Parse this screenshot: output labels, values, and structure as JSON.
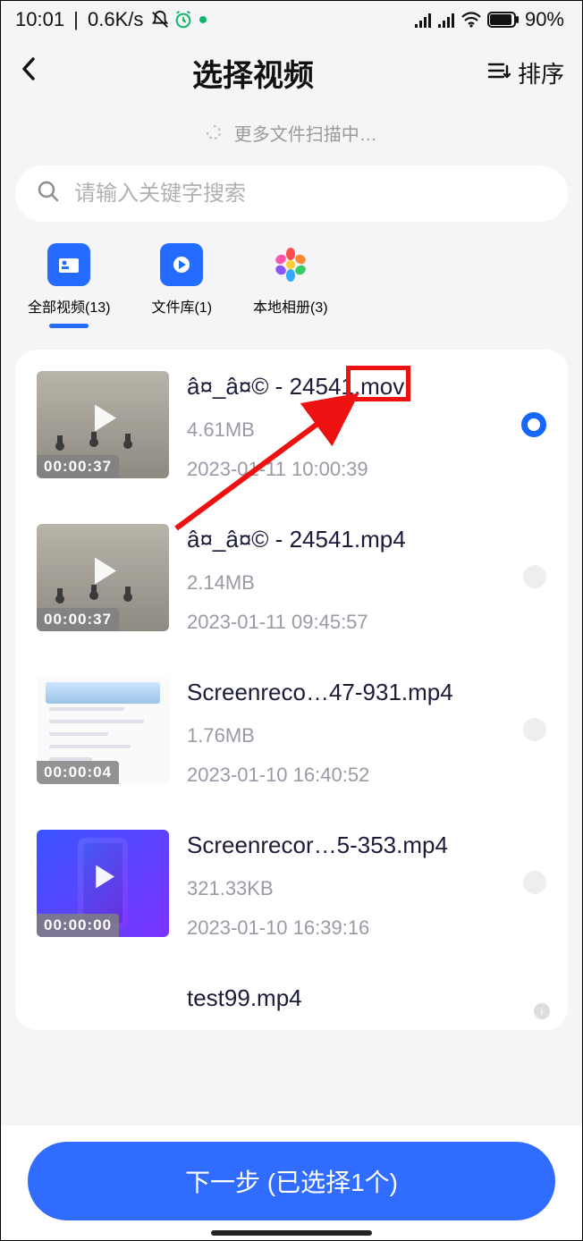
{
  "status": {
    "time": "10:01",
    "speed": "0.6K/s",
    "battery_text": "90%"
  },
  "nav": {
    "title": "选择视频",
    "sort_label": "排序"
  },
  "scanning_text": "更多文件扫描中…",
  "search": {
    "placeholder": "请输入关键字搜索"
  },
  "tabs": [
    {
      "label": "全部视频(13)",
      "active": true
    },
    {
      "label": "文件库(1)",
      "active": false
    },
    {
      "label": "本地相册(3)",
      "active": false
    }
  ],
  "annotation": {
    "highlight_text": "mov"
  },
  "videos": [
    {
      "name_prefix": "â¤_â¤© - 24541.",
      "name_ext": "mov",
      "size": "4.61MB",
      "time": "2023-01-11 10:00:39",
      "duration": "00:00:37",
      "selected": true,
      "thumb_style": "beach"
    },
    {
      "name_prefix": "â¤_â¤© - 24541.mp4",
      "name_ext": "",
      "size": "2.14MB",
      "time": "2023-01-11 09:45:57",
      "duration": "00:00:37",
      "selected": false,
      "thumb_style": "beach"
    },
    {
      "name_prefix": "Screenreco…47-931.mp4",
      "name_ext": "",
      "size": "1.76MB",
      "time": "2023-01-10 16:40:52",
      "duration": "00:00:04",
      "selected": false,
      "thumb_style": "screen"
    },
    {
      "name_prefix": "Screenrecor…5-353.mp4",
      "name_ext": "",
      "size": "321.33KB",
      "time": "2023-01-10 16:39:16",
      "duration": "00:00:00",
      "selected": false,
      "thumb_style": "phone"
    },
    {
      "name_prefix": "test99.mp4",
      "name_ext": "",
      "size": "",
      "time": "",
      "duration": "",
      "selected": false,
      "thumb_style": "blank"
    }
  ],
  "footer": {
    "next_label": "下一步 (已选择1个)"
  }
}
